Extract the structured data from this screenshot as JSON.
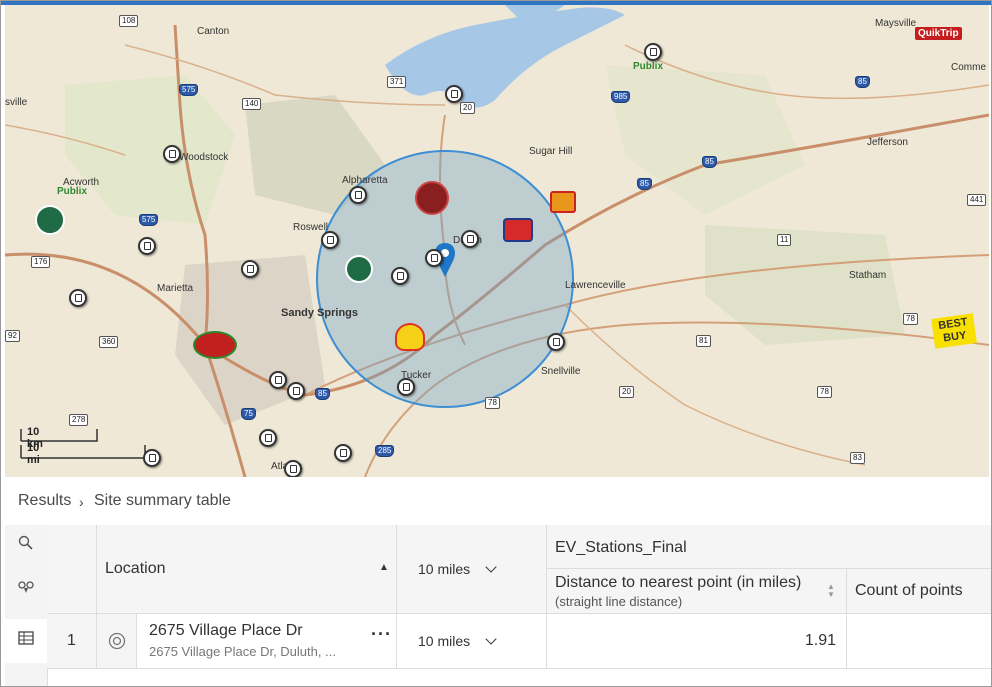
{
  "map": {
    "labels": {
      "canton": "Canton",
      "woodstock": "Woodstock",
      "acworth": "Acworth",
      "marietta": "Marietta",
      "sandy_springs": "Sandy Springs",
      "alpharetta": "Alpharetta",
      "roswell": "Roswell",
      "duluth": "Duluth",
      "sugar_hill": "Sugar Hill",
      "lawrenceville": "Lawrenceville",
      "snellville": "Snellville",
      "tucker": "Tucker",
      "atlanta": "Atlanta",
      "statham": "Statham",
      "jefferson": "Jefferson",
      "maysville": "Maysville",
      "commerce": "Comme",
      "sville": "sville"
    },
    "shields": [
      "108",
      "575",
      "140",
      "371",
      "20",
      "985",
      "85",
      "85",
      "85",
      "441",
      "575",
      "176",
      "11",
      "360",
      "81",
      "78",
      "75",
      "285",
      "20",
      "78",
      "78",
      "83",
      "278",
      "92",
      "85"
    ],
    "brands": {
      "quiktrip": "QuikTrip",
      "bestbuy_line1": "BEST",
      "bestbuy_line2": "BUY",
      "publix1": "Publix",
      "publix2": "Publix"
    },
    "scale": {
      "km": "10 km",
      "mi": "10 mi"
    }
  },
  "breadcrumb": {
    "results": "Results",
    "separator": "›",
    "current": "Site summary table"
  },
  "table": {
    "location_header": "Location",
    "buffer_header": "10 miles",
    "layer_header": "EV_Stations_Final",
    "distance_header": "Distance to nearest point (in miles)",
    "distance_subheader": "(straight line distance)",
    "count_header": "Count of points",
    "rows": [
      {
        "index": "1",
        "name": "2675 Village Place Dr",
        "address": "2675 Village Place Dr, Duluth, ...",
        "buffer": "10 miles",
        "distance": "1.91",
        "count": ""
      }
    ]
  }
}
